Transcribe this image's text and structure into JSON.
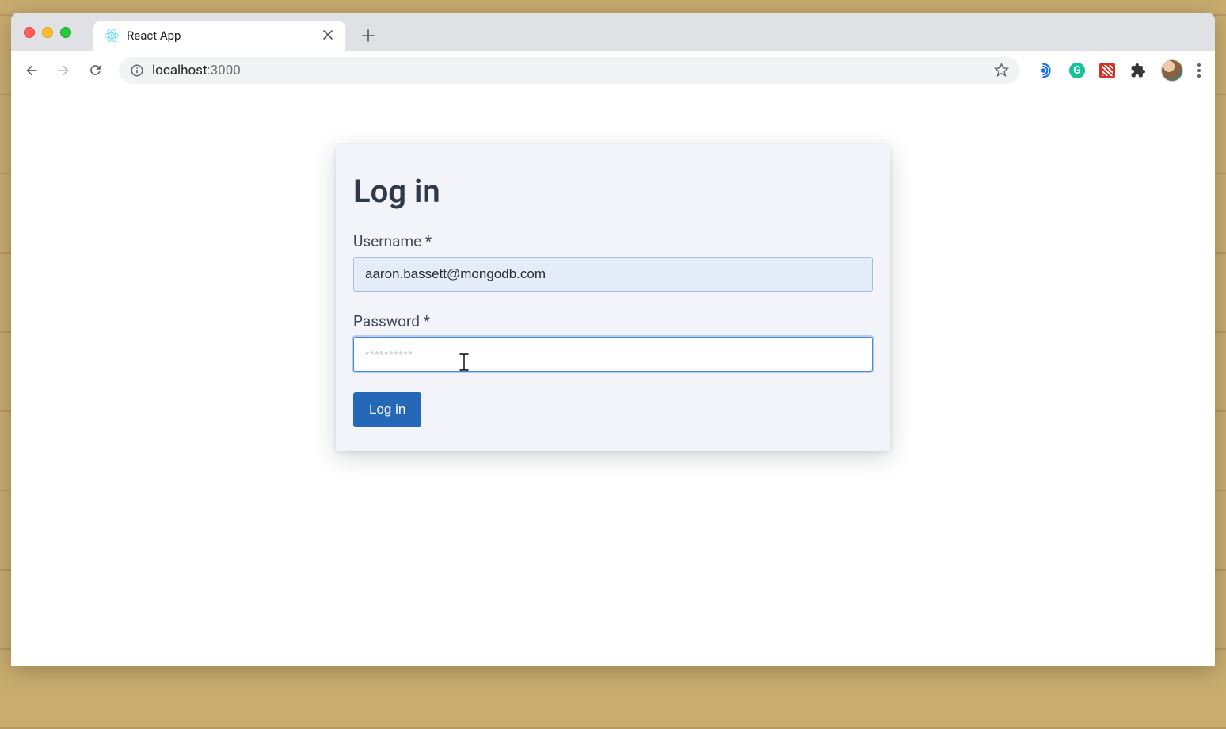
{
  "browser": {
    "tab_title": "React App",
    "url_host": "localhost",
    "url_path": ":3000"
  },
  "login": {
    "title": "Log in",
    "username_label": "Username *",
    "username_value": "aaron.bassett@mongodb.com",
    "password_label": "Password *",
    "password_placeholder": "**********",
    "password_value": "",
    "submit_label": "Log in"
  },
  "colors": {
    "card_bg": "#f2f4f9",
    "primary": "#2668b8"
  }
}
